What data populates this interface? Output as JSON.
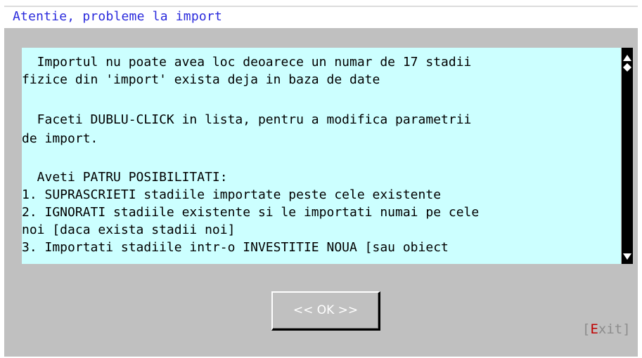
{
  "dialog": {
    "title": "Atentie, probleme la import",
    "message_lines": [
      "  Importul nu poate avea loc deoarece un numar de 17 stadii",
      "fizice din 'import' exista deja in baza de date",
      "",
      "  Faceti DUBLU-CLICK in lista, pentru a modifica parametrii",
      "de import.",
      "",
      "  Aveti PATRU POSIBILITATI:",
      "1. SUPRASCRIETI stadiile importate peste cele existente",
      "2. IGNORATI stadiile existente si le importati numai pe cele",
      "noi [daca exista stadii noi]",
      "3. Importati stadiile intr-o INVESTITIE NOUA [sau obiect"
    ],
    "ok_button_label": "<< OK >>",
    "exit_button": {
      "open_bracket": "[",
      "hotkey": "E",
      "rest": "xit",
      "close_bracket": "]"
    }
  },
  "colors": {
    "title_text": "#2a2adc",
    "message_background": "#ccffff",
    "dialog_background": "#c0c0c0",
    "scrollbar": "#000000",
    "exit_hotkey": "#c00000",
    "exit_text": "#8c8c8c"
  },
  "icons": {
    "scroll_up": "scroll-up-arrow-icon",
    "scroll_thumb": "scroll-thumb-diamond-icon",
    "scroll_down": "scroll-down-arrow-icon"
  }
}
